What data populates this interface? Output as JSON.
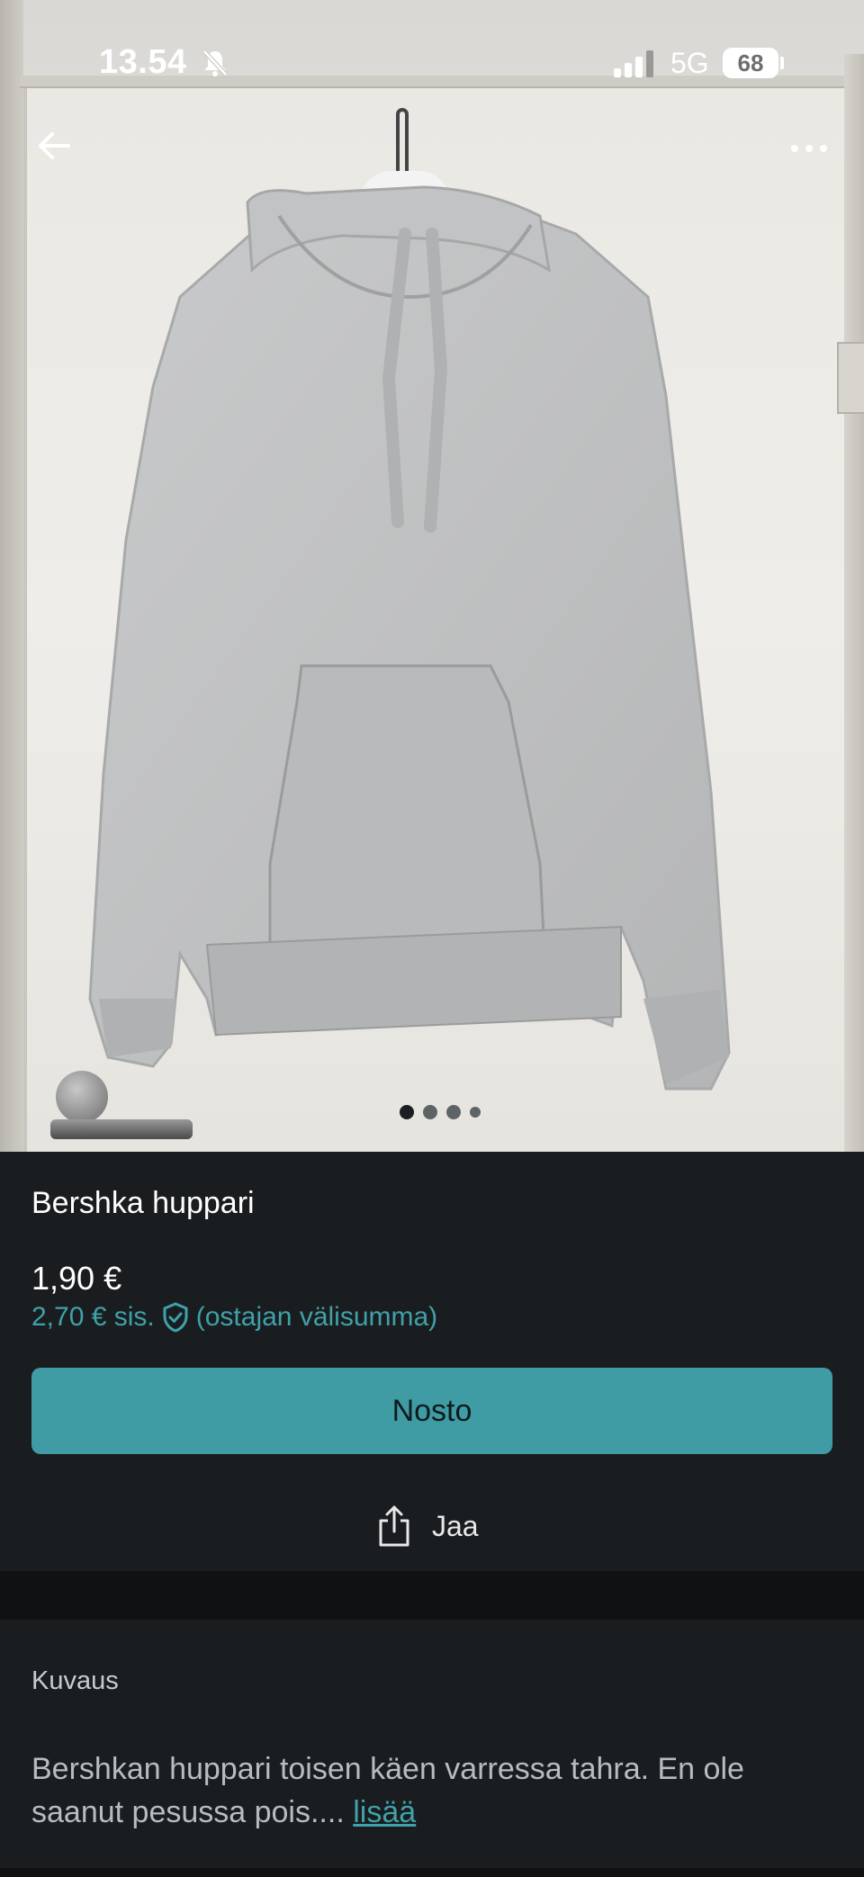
{
  "status_bar": {
    "time": "13.54",
    "network": "5G",
    "battery": "68",
    "icons": [
      "bell-muted-icon",
      "signal-icon",
      "battery-icon"
    ]
  },
  "top_bar": {
    "back_icon": "arrow-left-icon",
    "more_icon": "more-dots-icon"
  },
  "gallery": {
    "image_count": 4,
    "active_index": 0
  },
  "listing": {
    "title": "Bershka huppari",
    "price": "1,90 €",
    "total_price": "2,70 € sis.",
    "protection_note": "(ostajan välisumma)",
    "buy_label": "Nosto",
    "share_label": "Jaa"
  },
  "description": {
    "heading": "Kuvaus",
    "text": "Bershkan huppari toisen käen varressa tahra. En ole saanut pesussa pois....",
    "more_label": "lisää"
  },
  "colors": {
    "accent": "#3f9ba4",
    "accent_text": "#3fa1a9",
    "background": "#1a1d20",
    "divider": "#0f1113"
  }
}
